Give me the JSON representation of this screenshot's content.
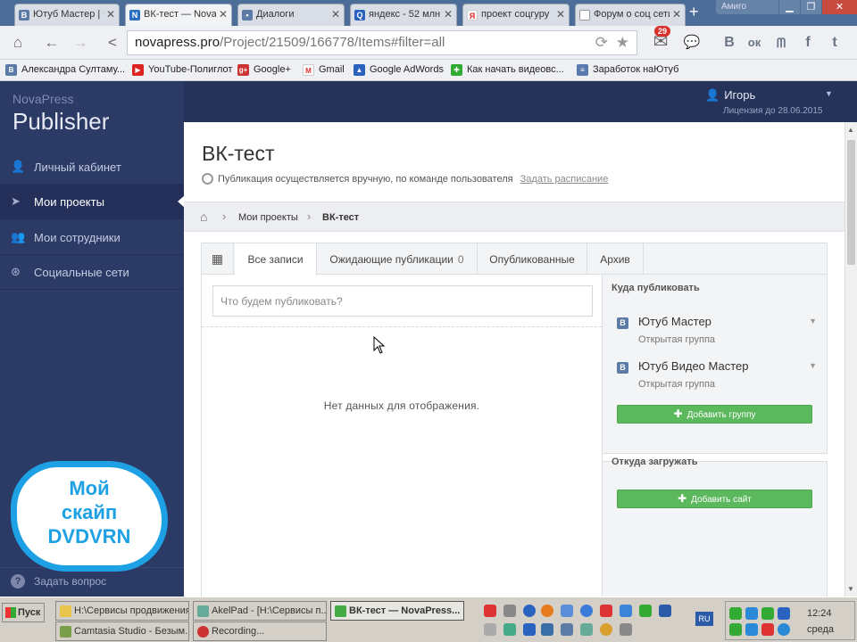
{
  "browser": {
    "tabs": [
      {
        "label": "Ютуб Мастер | С",
        "icon": "vk-icon"
      },
      {
        "label": "ВК-тест — NovaI",
        "icon": "novapress-icon",
        "active": true
      },
      {
        "label": "Диалоги",
        "icon": "dialogs-icon"
      },
      {
        "label": "яндекс - 52 млн",
        "icon": "yandex-search-icon"
      },
      {
        "label": "проект соцгуру",
        "icon": "yandex-icon"
      },
      {
        "label": "Форум о соц сети",
        "icon": "page-icon"
      }
    ],
    "amigo_label": "Амиго",
    "url_host": "novapress.pro",
    "url_path": "/Project/21509/166778/Items#filter=all",
    "mail_badge": "29",
    "social_buttons": [
      "В",
      "ок",
      "ᗰ",
      "f",
      "t"
    ],
    "bookmarks": [
      "Александра Султаму...",
      "YouTube-Полиглот",
      "Google+",
      "Gmail",
      "Google AdWords",
      "Как начать видеовс...",
      "Заработок наЮтуб"
    ]
  },
  "app": {
    "brand_small": "NovaPress",
    "brand_big": "Publisher",
    "user_name": "Игорь",
    "license": "Лицензия до 28.06.2015",
    "nav": [
      {
        "label": "Личный кабинет",
        "icon": "user-icon"
      },
      {
        "label": "Мои проекты",
        "icon": "send-icon",
        "active": true
      },
      {
        "label": "Мои сотрудники",
        "icon": "users-icon"
      },
      {
        "label": "Социальные сети",
        "icon": "globe-icon"
      }
    ],
    "help_label": "Задать вопрос",
    "sticker_text": [
      "Мой",
      "скайп",
      "DVDVRN"
    ]
  },
  "page": {
    "title": "ВК-тест",
    "publish_note": "Публикация осуществляется вручную, по команде пользователя",
    "schedule_link": "Задать расписание",
    "breadcrumb": [
      "Мои проекты",
      "ВК-тест"
    ],
    "tabs": [
      {
        "label": "Все записи",
        "active": true
      },
      {
        "label": "Ожидающие публикации",
        "count": "0"
      },
      {
        "label": "Опубликованные"
      },
      {
        "label": "Архив"
      }
    ],
    "compose_placeholder": "Что будем публиковать?",
    "empty_text": "Нет данных для отображения.",
    "where_title": "Куда публиковать",
    "groups": [
      {
        "name": "Ютуб Мастер",
        "type": "Открытая группа"
      },
      {
        "name": "Ютуб Видео Мастер",
        "type": "Открытая группа"
      }
    ],
    "add_group_label": "Добавить группу",
    "from_title": "Откуда загружать",
    "add_site_label": "Добавить сайт"
  },
  "taskbar": {
    "start_label": "Пуск",
    "tasks": [
      "H:\\Сервисы продвижения",
      "AkelPad - [H:\\Сервисы п...",
      "ВК-тест — NovaPress...",
      "Camtasia Studio - Безым...",
      "Recording..."
    ],
    "lang": "RU",
    "time": "12:24",
    "day": "среда"
  },
  "colors": {
    "sidebar": "#2c3a66",
    "accent_green": "#5cb85c",
    "skype_blue": "#1ea0e4"
  }
}
